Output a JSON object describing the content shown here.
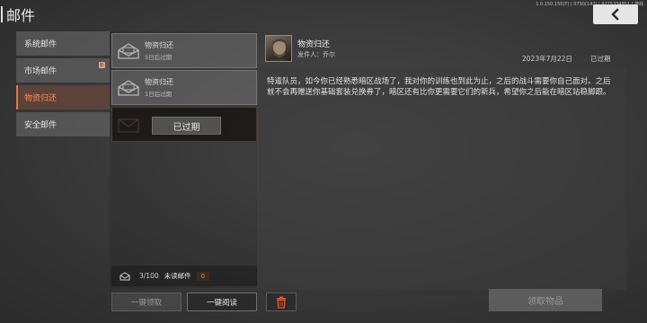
{
  "header": {
    "title": "邮件",
    "version": "1.0.150.150(T) | 0730(142) | 9225334851 | 游戏"
  },
  "categories": [
    {
      "label": "系统邮件",
      "active": false
    },
    {
      "label": "市场邮件",
      "active": false,
      "badge": "新"
    },
    {
      "label": "物资归还",
      "active": true
    },
    {
      "label": "安全邮件",
      "active": false
    }
  ],
  "mails": [
    {
      "title": "物资归还",
      "subtitle": "5日后过期"
    },
    {
      "title": "物资归还",
      "subtitle": "1日后过期"
    },
    {
      "overlay": "已过期"
    }
  ],
  "footer": {
    "count": "3/100",
    "unread_label": "未读邮件",
    "unread_count": "0",
    "claim_all": "一键领取",
    "read_all": "一键阅读",
    "claim_items": "领取物品"
  },
  "detail": {
    "title": "物资归还",
    "sender": "发件人：乔尔",
    "date": "2023年7月22日",
    "status": "已过期",
    "body": "特遣队员，如今你已经熟悉暗区战场了，我对你的训练也到此为止，之后的战斗需要你自己面对。之后就不会再赠送你基础套装兑换券了，暗区还有比你更需要它们的新兵，希望你之后能在暗区站稳脚跟。"
  },
  "colors": {
    "accent": "#ff8a52",
    "active_bg": "#5c4339",
    "delete_icon": "#e0582e"
  }
}
